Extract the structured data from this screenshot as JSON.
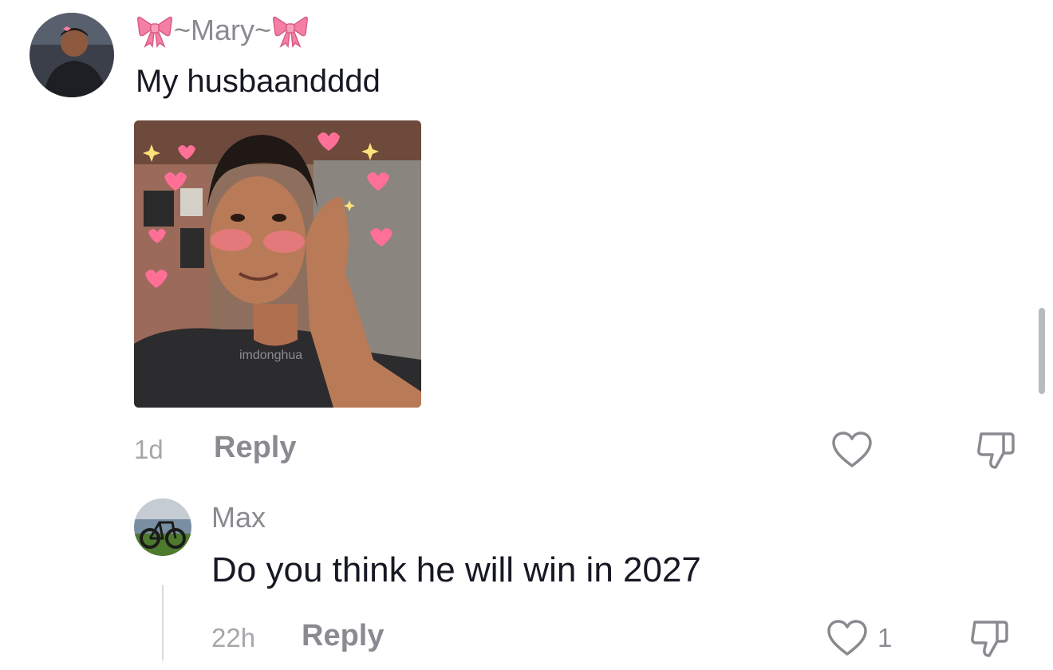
{
  "comments": [
    {
      "username": "~Mary~",
      "text": "My husbaandddd",
      "image_watermark": "imdonghua",
      "time": "1d",
      "reply_label": "Reply",
      "icons": {
        "user_decoration": "ribbon-bow-icon",
        "like": "heart-outline-icon",
        "dislike": "thumbs-down-icon"
      }
    },
    {
      "username": "Max",
      "text": "Do you think he will win in 2027",
      "time": "22h",
      "reply_label": "Reply",
      "like_count": "1",
      "icons": {
        "like": "heart-outline-icon",
        "dislike": "thumbs-down-icon"
      }
    }
  ],
  "colors": {
    "text_primary": "#161823",
    "text_secondary": "#8a8b91",
    "bow_pink": "#f47fa3",
    "background": "#ffffff"
  }
}
